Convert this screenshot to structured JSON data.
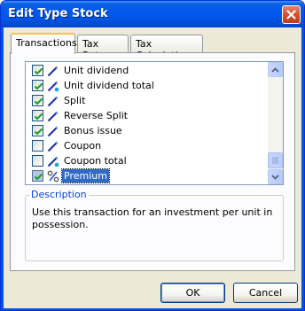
{
  "window": {
    "title": "Edit Type Stock"
  },
  "tabs": [
    {
      "label": "Transactions",
      "active": true
    },
    {
      "label": "Tax Rates",
      "active": false
    },
    {
      "label": "Tax Calculation",
      "active": false
    }
  ],
  "transactions": {
    "items": [
      {
        "label": "Unit dividend",
        "checked": true,
        "icon": "pen-blue-icon",
        "selected": false
      },
      {
        "label": "Unit dividend total",
        "checked": true,
        "icon": "pen-blue-dot-icon",
        "selected": false
      },
      {
        "label": "Split",
        "checked": true,
        "icon": "pen-blue-icon",
        "selected": false
      },
      {
        "label": "Reverse Split",
        "checked": true,
        "icon": "pen-blue-icon",
        "selected": false
      },
      {
        "label": "Bonus issue",
        "checked": true,
        "icon": "pen-blue-icon",
        "selected": false
      },
      {
        "label": "Coupon",
        "checked": false,
        "icon": "pen-blue-icon",
        "selected": false
      },
      {
        "label": "Coupon total",
        "checked": false,
        "icon": "pen-blue-dot-icon",
        "selected": false
      },
      {
        "label": "Premium",
        "checked": true,
        "icon": "percent-icon",
        "selected": true
      }
    ]
  },
  "description": {
    "legend": "Description",
    "text": "Use this transaction for an investment per unit in possession."
  },
  "buttons": {
    "ok": "OK",
    "cancel": "Cancel"
  },
  "colors": {
    "titlebar": "#0054e3",
    "selection": "#316ac5",
    "legend": "#0046d5",
    "check": "#21a121"
  }
}
